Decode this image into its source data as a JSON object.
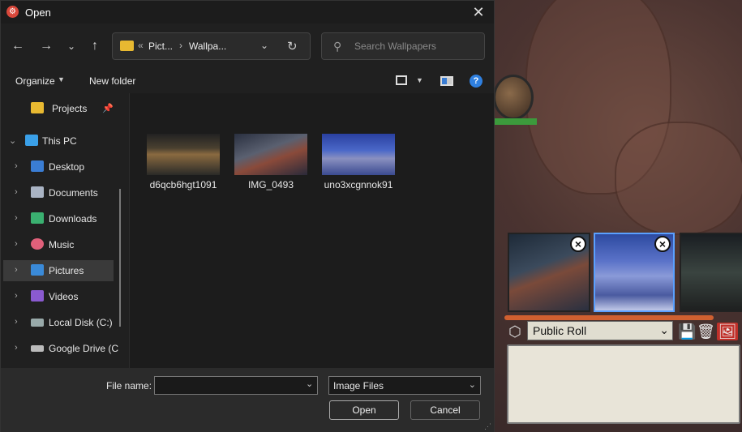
{
  "dialog": {
    "title": "Open",
    "close_glyph": "✕"
  },
  "nav": {
    "back_glyph": "←",
    "forward_glyph": "→",
    "recent_glyph": "⌄",
    "up_glyph": "↑",
    "address": {
      "overflow": "«",
      "crumbs": [
        "Pict...",
        "Wallpa..."
      ],
      "separator": "›",
      "dropdown_glyph": "⌄",
      "refresh_glyph": "↻"
    },
    "search": {
      "placeholder": "Search Wallpapers",
      "icon_glyph": "⚲"
    }
  },
  "toolbar": {
    "organize": "Organize",
    "new_folder": "New folder",
    "caret": "▼",
    "help": "?"
  },
  "sidebar": {
    "items": [
      {
        "label": "Projects",
        "icon": "folder-icon",
        "color": "#e8b931",
        "pinned": true
      },
      {
        "label": "This PC",
        "icon": "computer-icon",
        "color": "#3aa0e8",
        "expanded": true
      },
      {
        "label": "Desktop",
        "icon": "desktop-icon",
        "color": "#3a7dd4"
      },
      {
        "label": "Documents",
        "icon": "documents-icon",
        "color": "#aab4c4"
      },
      {
        "label": "Downloads",
        "icon": "downloads-icon",
        "color": "#3ab070"
      },
      {
        "label": "Music",
        "icon": "music-icon",
        "color": "#e0607a"
      },
      {
        "label": "Pictures",
        "icon": "pictures-icon",
        "color": "#3a8ad8",
        "selected": true
      },
      {
        "label": "Videos",
        "icon": "videos-icon",
        "color": "#8a5ad0"
      },
      {
        "label": "Local Disk (C:)",
        "icon": "drive-icon",
        "color": "#9aa"
      },
      {
        "label": "Google Drive (C",
        "icon": "drive-icon",
        "color": "#bbb"
      }
    ],
    "chevron_right": "›",
    "chevron_down": "⌄",
    "pin_glyph": "📌"
  },
  "files": [
    {
      "name": "d6qcb6hgt1091"
    },
    {
      "name": "IMG_0493"
    },
    {
      "name": "uno3xcgnnok91"
    }
  ],
  "footer": {
    "file_name_label": "File name:",
    "file_name_value": "",
    "file_type": "Image Files",
    "dropdown_glyph": "⌄",
    "open": "Open",
    "cancel": "Cancel",
    "grip_glyph": "⋰"
  },
  "background_app": {
    "roll_mode": "Public Roll",
    "roll_chevron": "⌄",
    "remove_glyph": "×",
    "d20_glyph": "⬡",
    "save_glyph": "💾",
    "trash_glyph": "🗑",
    "image_glyph": "🖼"
  }
}
